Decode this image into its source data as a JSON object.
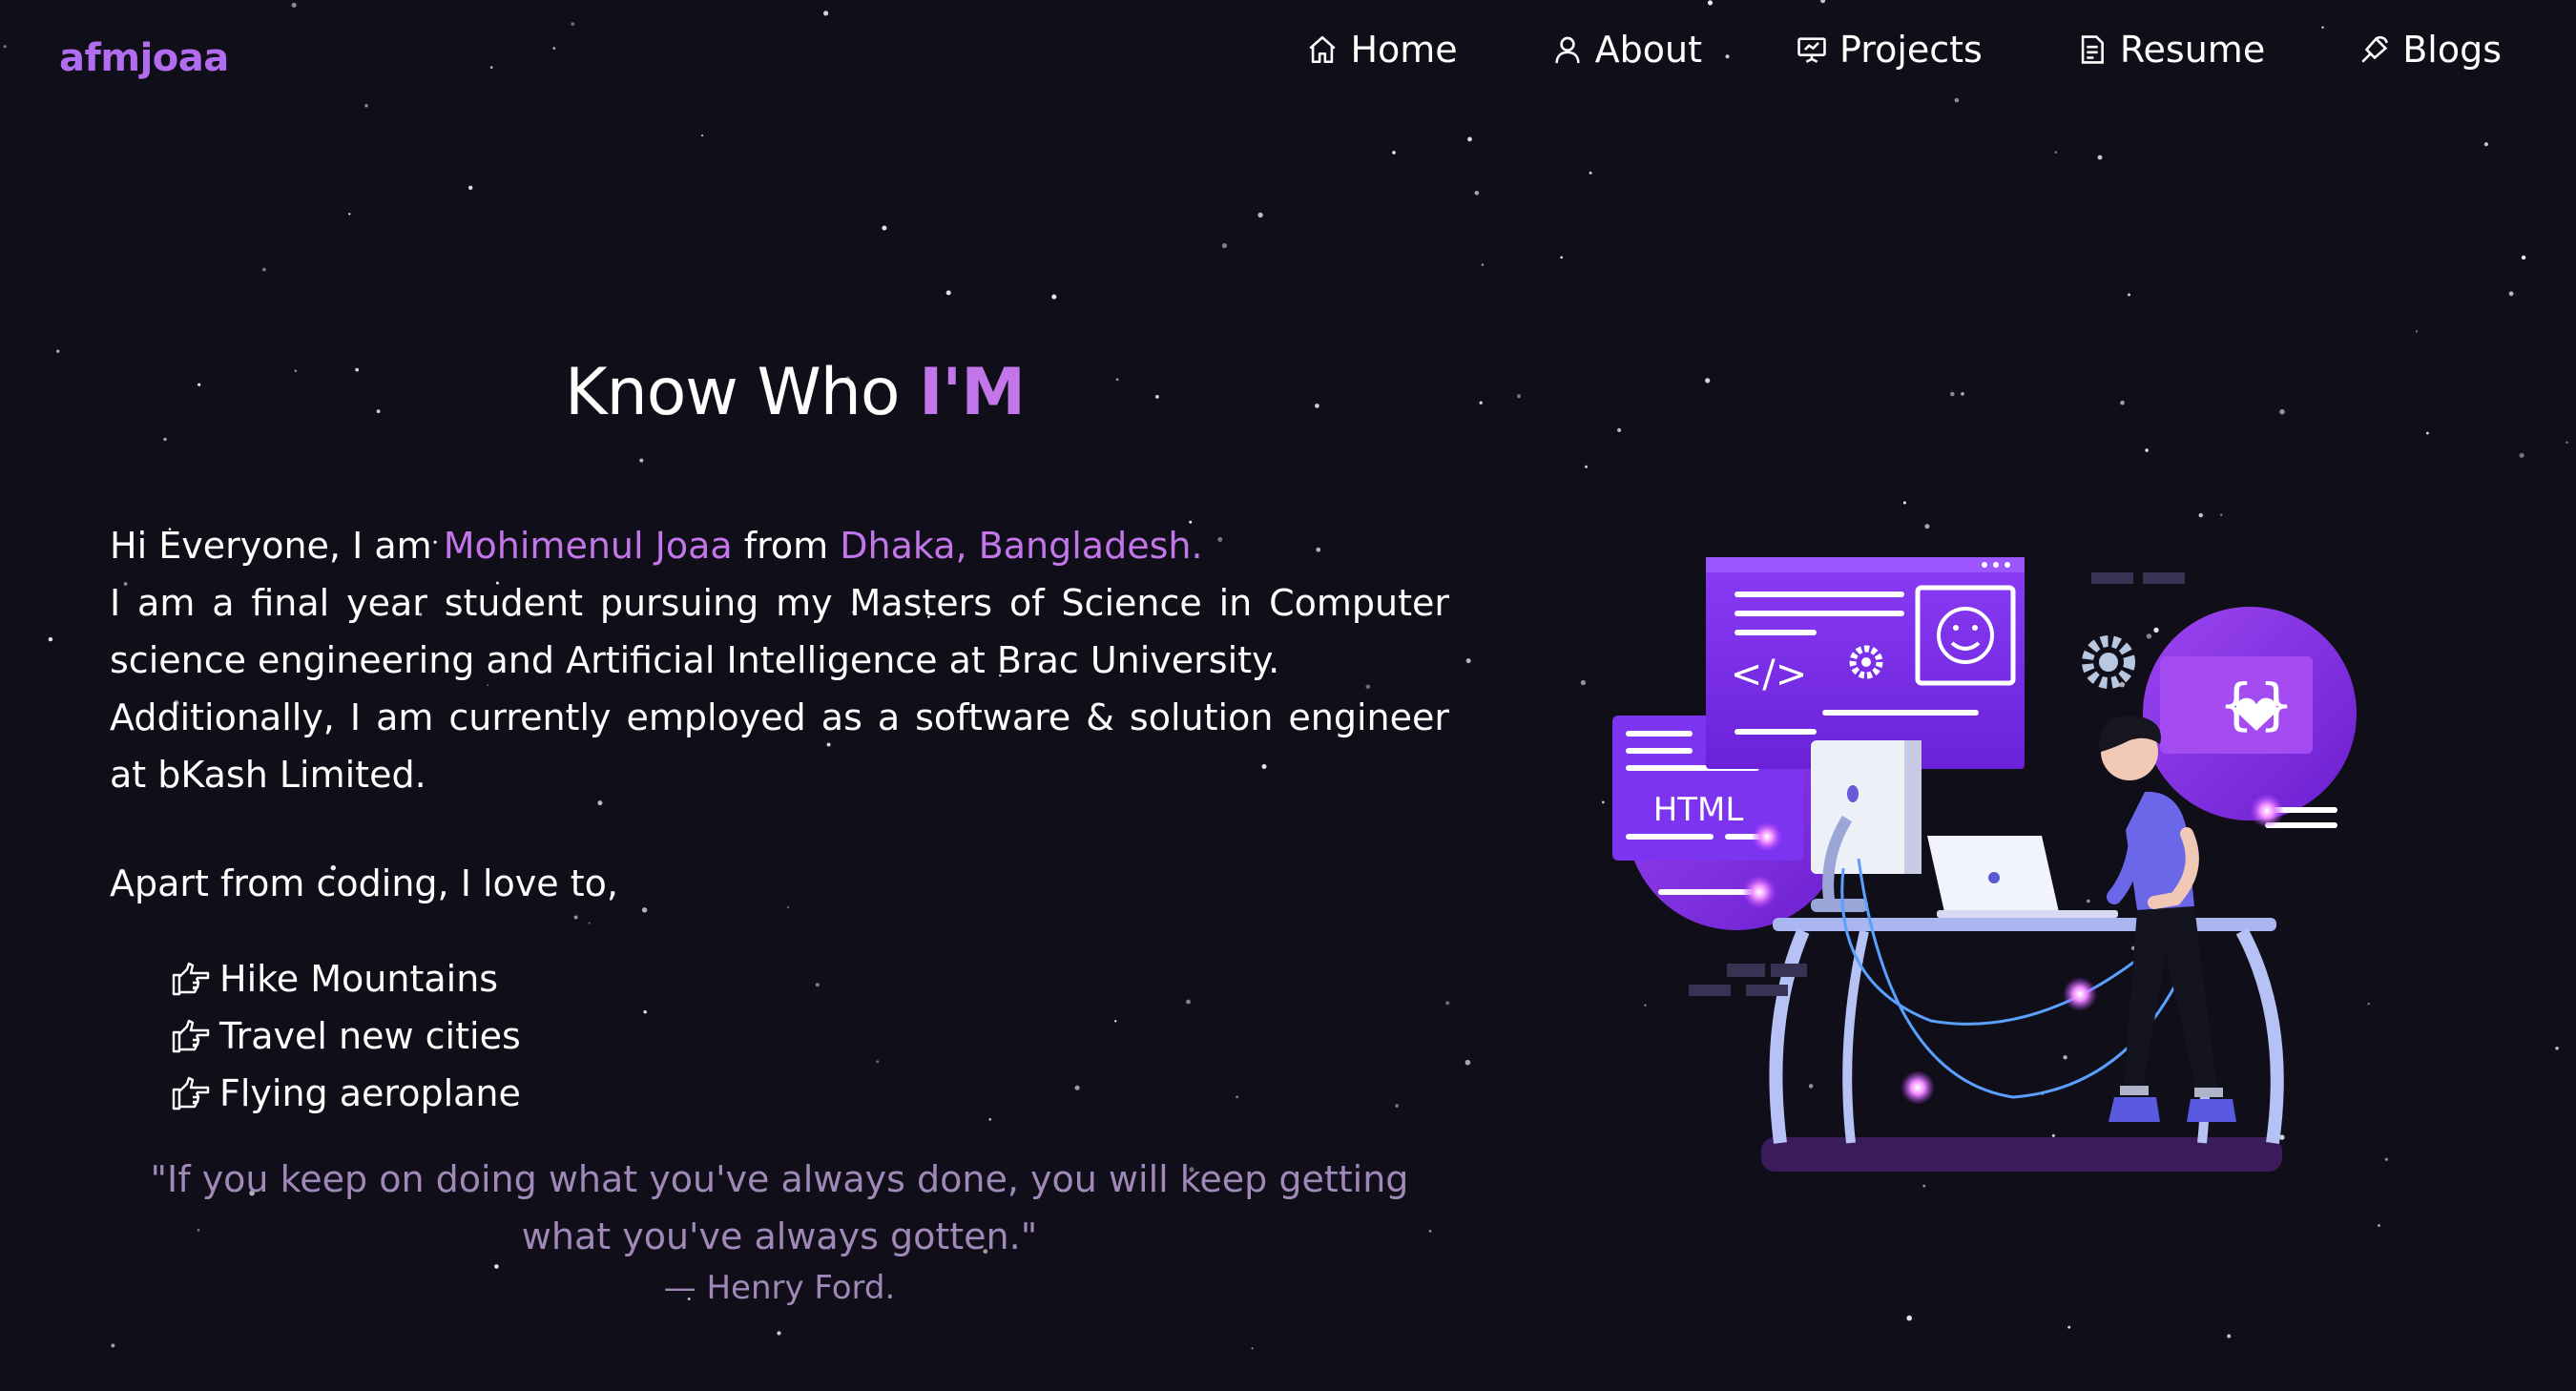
{
  "brand": "afmjoaa",
  "nav": [
    {
      "label": "Home",
      "icon": "home-icon"
    },
    {
      "label": "About",
      "icon": "user-icon"
    },
    {
      "label": "Projects",
      "icon": "presentation-icon"
    },
    {
      "label": "Resume",
      "icon": "document-icon"
    },
    {
      "label": "Blogs",
      "icon": "pen-icon"
    }
  ],
  "heading": {
    "prefix": "Know Who ",
    "accent": "I'M"
  },
  "about": {
    "intro_pre": "Hi Everyone, I am ",
    "name": "Mohimenul Joaa",
    "intro_mid": " from ",
    "location": "Dhaka, Bangladesh.",
    "line2": "I am a final year student pursuing my Masters of Science in Computer science engineering and Artificial Intelligence at Brac University.",
    "line3": "Additionally, I am currently employed as a software & solution engineer at bKash Limited."
  },
  "apart": "Apart from coding, I love to,",
  "hobbies": [
    "Hike Mountains",
    "Travel new cities",
    "Flying aeroplane"
  ],
  "quote": {
    "text": "\"If you keep on doing what you've always done, you will keep getting what you've always gotten.\"",
    "author": "— Henry Ford."
  },
  "illustration": {
    "label": "HTML"
  },
  "colors": {
    "background": "#100e18",
    "accent": "#c276ea",
    "quote": "#a088b8",
    "illustration_purple": "#7b2ff0"
  }
}
